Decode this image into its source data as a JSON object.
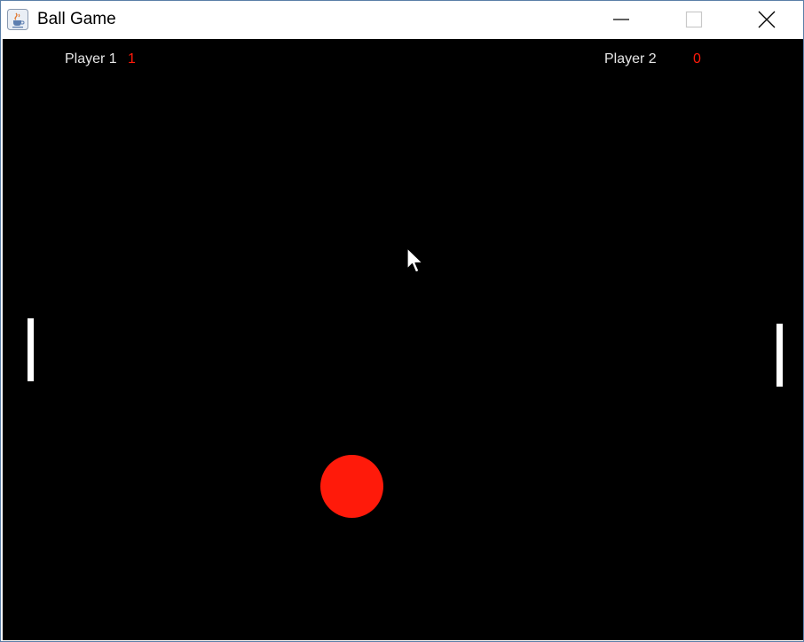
{
  "window": {
    "title": "Ball Game",
    "icon": "java-cup-icon",
    "controls": [
      "minimize-icon",
      "maximize-icon",
      "close-icon"
    ]
  },
  "game": {
    "background_color": "#000000",
    "player1": {
      "label": "Player 1",
      "score": "1"
    },
    "player2": {
      "label": "Player 2",
      "score": "0"
    },
    "score_color": "#ff1a0a",
    "paddle_color": "#ffffff",
    "ball_color": "#ff1a0a",
    "cursor": "arrow-cursor-icon"
  }
}
